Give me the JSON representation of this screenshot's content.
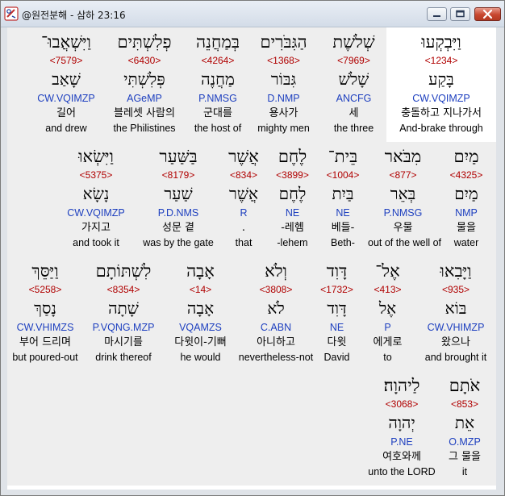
{
  "window": {
    "title": "@원전분해 - 삼하 23:16"
  },
  "rows": [
    [
      {
        "heb": "וַיִּבְקְעוּ",
        "strong": "<1234>",
        "lemma": "בָּקַע",
        "morph": "CW.VQIMZP",
        "korean": "충돌하고 지나가서",
        "english": "And-brake through",
        "selected": true
      },
      {
        "heb": "שְׁלֹשֶׁת",
        "strong": "<7969>",
        "lemma": "שָׁלֹשׁ",
        "morph": "ANCFG",
        "korean": "세",
        "english": "the three"
      },
      {
        "heb": "הַגִּבֹּרִים",
        "strong": "<1368>",
        "lemma": "גִּבּוֹר",
        "morph": "D.NMP",
        "korean": "용사가",
        "english": "mighty men"
      },
      {
        "heb": "בְּמַחֲנֵה",
        "strong": "<4264>",
        "lemma": "מַחֲנֶה",
        "morph": "P.NMSG",
        "korean": "군대를",
        "english": "the host of"
      },
      {
        "heb": "פְלִשְׁתִּים",
        "strong": "<6430>",
        "lemma": "פְּלִשְׁתִּי",
        "morph": "AGeMP",
        "korean": "블레셋 사람의",
        "english": "the Philistines"
      },
      {
        "heb": "וַיִּשְׁאֲבוּ־",
        "strong": "<7579>",
        "lemma": "שָׁאַב",
        "morph": "CW.VQIMZP",
        "korean": "길어",
        "english": "and drew"
      }
    ],
    [
      {
        "heb": "מַיִם",
        "strong": "<4325>",
        "lemma": "מַיִם",
        "morph": "NMP",
        "korean": "물을",
        "english": "water"
      },
      {
        "heb": "מִבֹּאר",
        "strong": "<877>",
        "lemma": "בְּאֵר",
        "morph": "P.NMSG",
        "korean": "우물",
        "english": "out of the well of"
      },
      {
        "heb": "בֵּית־",
        "strong": "<1004>",
        "lemma": "בַּיִת",
        "morph": "NE",
        "korean": "베들-",
        "english": "Beth-"
      },
      {
        "heb": "לֶחֶם",
        "strong": "<3899>",
        "lemma": "לֶחֶם",
        "morph": "NE",
        "korean": "-레헴",
        "english": "-lehem"
      },
      {
        "heb": "אֲשֶׁר",
        "strong": "<834>",
        "lemma": "אֲשֶׁר",
        "morph": "R",
        "korean": ".",
        "english": "that"
      },
      {
        "heb": "בַּשַּׁעַר",
        "strong": "<8179>",
        "lemma": "שַׁעַר",
        "morph": "P.D.NMS",
        "korean": "성문 곁",
        "english": "was by the gate"
      },
      {
        "heb": "וַיִּשְׂאוּ",
        "strong": "<5375>",
        "lemma": "נָשָׂא",
        "morph": "CW.VQIMZP",
        "korean": "가지고",
        "english": "and took it"
      }
    ],
    [
      {
        "heb": "וַיָּבִאוּ",
        "strong": "<935>",
        "lemma": "בּוֹא",
        "morph": "CW.VHIMZP",
        "korean": "왔으나",
        "english": "and brought it"
      },
      {
        "heb": "אֶל־",
        "strong": "<413>",
        "lemma": "אֶל",
        "morph": "P",
        "korean": "에게로",
        "english": "to"
      },
      {
        "heb": "דָּוִד",
        "strong": "<1732>",
        "lemma": "דָּוִד",
        "morph": "NE",
        "korean": "다윗",
        "english": "David"
      },
      {
        "heb": "וְלֹא",
        "strong": "<3808>",
        "lemma": "לֹא",
        "morph": "C.ABN",
        "korean": "아니하고",
        "english": "nevertheless-not"
      },
      {
        "heb": "אָבָה",
        "strong": "<14>",
        "lemma": "אָבָה",
        "morph": "VQAMZS",
        "korean": "다윗이-기뻐",
        "english": "he would"
      },
      {
        "heb": "לִשְׁתּוֹתָם",
        "strong": "<8354>",
        "lemma": "שָׁתָה",
        "morph": "P.VQNG.MZP",
        "korean": "마시기를",
        "english": "drink thereof"
      },
      {
        "heb": "וַיַּסֵּךְ",
        "strong": "<5258>",
        "lemma": "נָסַךְ",
        "morph": "CW.VHIMZS",
        "korean": "부어 드리며",
        "english": "but poured-out"
      }
    ],
    [
      {
        "heb": "אֹתָם",
        "strong": "<853>",
        "lemma": "אֵת",
        "morph": "O.MZP",
        "korean": "그 물을",
        "english": "it"
      },
      {
        "heb": "לַיהוָה׃",
        "strong": "<3068>",
        "lemma": "יְהוָה",
        "morph": "P.NE",
        "korean": "여호와께",
        "english": "unto the LORD"
      }
    ]
  ]
}
